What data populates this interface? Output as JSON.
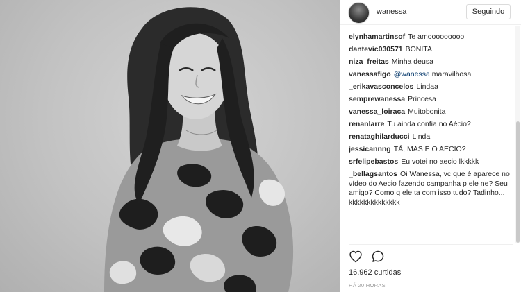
{
  "post": {
    "username": "wanessa",
    "follow_label": "Seguindo",
    "likes": "16.962 curtidas",
    "timestamp": "HÁ 20 HORAS"
  },
  "comments": [
    {
      "author": "",
      "text": "linda"
    },
    {
      "author": "elynhamartinsof",
      "text": "Te amooooooooo"
    },
    {
      "author": "dantevic030571",
      "text": "BONITA"
    },
    {
      "author": "niza_freitas",
      "text": "Minha deusa"
    },
    {
      "author": "vanessafigo",
      "mention": "@wanessa",
      "text": "maravilhosa"
    },
    {
      "author": "_erikavasconcelos",
      "text": "Lindaa"
    },
    {
      "author": "semprewanessa",
      "text": "Princesa"
    },
    {
      "author": "vanessa_loiraca",
      "text": "Muitobonita"
    },
    {
      "author": "renanlarre",
      "text": "Tu ainda confia no Aécio?"
    },
    {
      "author": "renataghilarducci",
      "text": "Linda"
    },
    {
      "author": "jessicannng",
      "text": "TÁ, MAS E O AECIO?"
    },
    {
      "author": "srfelipebastos",
      "text": "Eu votei no aecio lkkkkk"
    },
    {
      "author": "_bellagsantos",
      "text": "Oi Wanessa, vc que é aparece no vídeo do Aecio fazendo campanha p ele ne? Seu amigo? Como q ele ta com isso tudo? Tadinho... kkkkkkkkkkkkkk"
    }
  ],
  "icons": {
    "like": "heart-icon",
    "comment": "comment-bubble-icon"
  }
}
